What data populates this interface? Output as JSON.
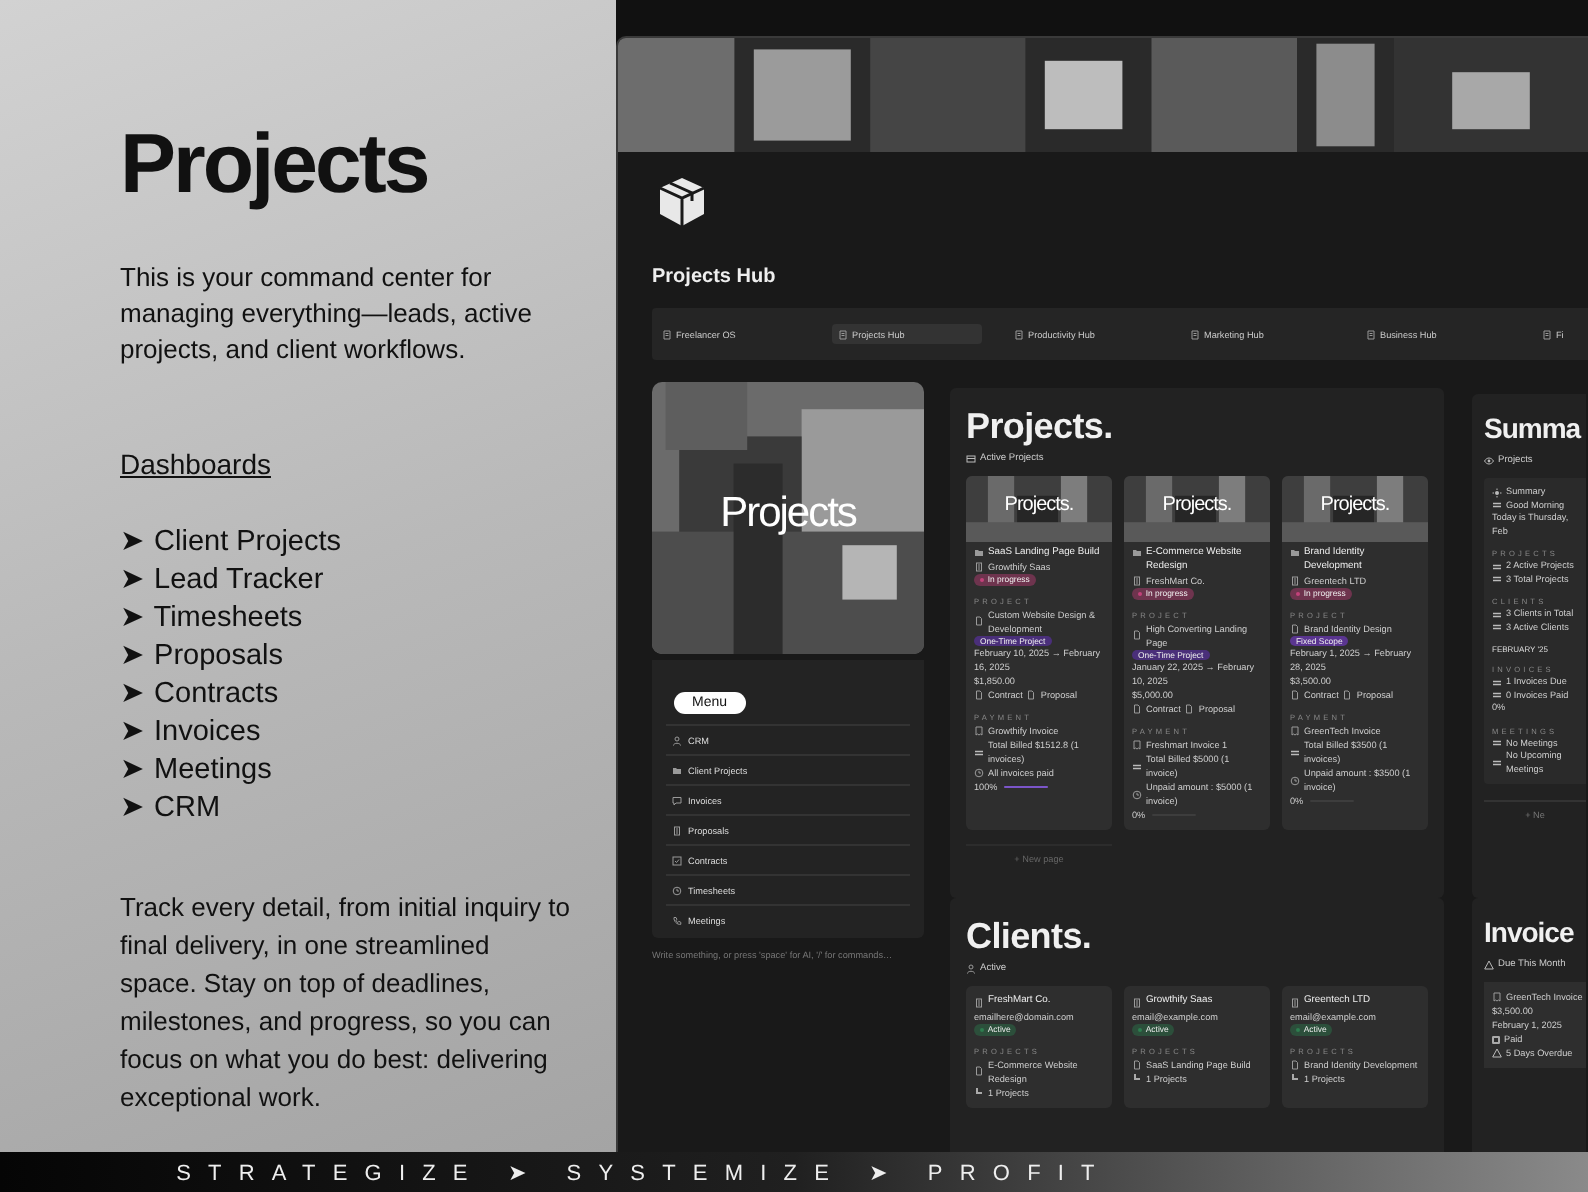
{
  "promo": {
    "title": "Projects",
    "intro": "This is your command center for managing everything—leads, active projects, and client workflows.",
    "dashboards_heading": "Dashboards",
    "dashboards": [
      "➤ Client Projects",
      "➤ Lead Tracker",
      "➤ Timesheets",
      "➤ Proposals",
      "➤ Contracts",
      "➤ Invoices",
      "➤ Meetings",
      "➤ CRM"
    ],
    "outro": "Track every detail, from initial inquiry to final delivery, in one streamlined space. Stay on top of deadlines, milestones, and progress, so you can focus on what you do best: delivering exceptional work."
  },
  "hub": {
    "title": "Projects Hub",
    "nav": [
      {
        "label": "Freelancer OS",
        "selected": false
      },
      {
        "label": "Projects Hub",
        "selected": true
      },
      {
        "label": "Productivity Hub",
        "selected": false
      },
      {
        "label": "Marketing Hub",
        "selected": false
      },
      {
        "label": "Business Hub",
        "selected": false
      },
      {
        "label": "Fi",
        "selected": false
      }
    ],
    "cover": {
      "title": "Projects"
    },
    "menu": {
      "title": "Menu",
      "items": [
        "CRM",
        "Client Projects",
        "Invoices",
        "Proposals",
        "Contracts",
        "Timesheets",
        "Meetings"
      ]
    },
    "placeholder": "Write something, or press 'space' for AI, '/' for commands…",
    "projects": {
      "title": "Projects.",
      "view": "Active Projects",
      "new_button": "+ New page",
      "cards": [
        {
          "image_label": "Projects.",
          "title": "SaaS Landing Page Build",
          "client": "Growthify Saas",
          "status": {
            "label": "In progress",
            "color": "#c2417a"
          },
          "project_heading": "PROJECT",
          "project": "Custom Website Design & Development",
          "type": {
            "label": "One-Time Project",
            "color": "#4a2f7a"
          },
          "dates": "February 10, 2025 → February 16, 2025",
          "amount": "$1,850.00",
          "docs": [
            "Contract",
            "Proposal"
          ],
          "payment_heading": "PAYMENT",
          "invoice": "Growthify Invoice",
          "billed": "Total Billed $1512.8 (1 invoices)",
          "balance": "All invoices paid",
          "percent": "100%",
          "level": 1
        },
        {
          "image_label": "Projects.",
          "title": "E-Commerce Website Redesign",
          "client": "FreshMart Co.",
          "status": {
            "label": "In progress",
            "color": "#c2417a"
          },
          "project_heading": "PROJECT",
          "project": "High Converting Landing Page",
          "type": {
            "label": "One-Time Project",
            "color": "#4a2f7a"
          },
          "dates": "January 22, 2025 → February 10, 2025",
          "amount": "$5,000.00",
          "docs": [
            "Contract",
            "Proposal"
          ],
          "payment_heading": "PAYMENT",
          "invoice": "Freshmart Invoice 1",
          "billed": "Total Billed $5000 (1 invoice)",
          "balance": "Unpaid amount : $5000 (1 invoice)",
          "percent": "0%",
          "level": 0
        },
        {
          "image_label": "Projects.",
          "title": "Brand Identity Development",
          "client": "Greentech LTD",
          "status": {
            "label": "In progress",
            "color": "#c2417a"
          },
          "project_heading": "PROJECT",
          "project": "Brand Identity Design",
          "type": {
            "label": "Fixed Scope",
            "color": "#5a3590"
          },
          "dates": "February 1, 2025 → February 28, 2025",
          "amount": "$3,500.00",
          "docs": [
            "Contract",
            "Proposal"
          ],
          "payment_heading": "PAYMENT",
          "invoice": "GreenTech Invoice",
          "billed": "Total Billed $3500 (1 invoices)",
          "balance": "Unpaid amount : $3500 (1 invoice)",
          "percent": "0%",
          "level": 0
        }
      ]
    },
    "summary": {
      "title": "Summa",
      "view": "Projects",
      "heading": "Summary",
      "greeting": "Good Morning",
      "date": "Today is Thursday, Feb",
      "sections": [
        {
          "label": "PROJECTS",
          "items": [
            "2 Active Projects",
            "3 Total Projects"
          ]
        },
        {
          "label": "CLIENTS",
          "items": [
            "3 Clients in Total",
            "3 Active Clients"
          ]
        },
        {
          "month": "FEBRUARY '25",
          "label": "INVOICES",
          "items": [
            "1 Invoices Due",
            "0 Invoices Paid"
          ],
          "percent": "0%"
        },
        {
          "label": "MEETINGS",
          "items": [
            "No Meetings",
            "No Upcoming Meetings"
          ]
        }
      ],
      "new_button": "+ Ne"
    },
    "clients": {
      "title": "Clients.",
      "view": "Active",
      "cards": [
        {
          "name": "FreshMart Co.",
          "email": "emailhere@domain.com",
          "status": {
            "label": "Active",
            "color": "#2e7d4f"
          },
          "projects_heading": "PROJECTS",
          "project": "E-Commerce Website Redesign",
          "count": "1 Projects"
        },
        {
          "name": "Growthify Saas",
          "email": "email@example.com",
          "status": {
            "label": "Active",
            "color": "#2e7d4f"
          },
          "projects_heading": "PROJECTS",
          "project": "SaaS Landing Page Build",
          "count": "1 Projects"
        },
        {
          "name": "Greentech LTD",
          "email": "email@example.com",
          "status": {
            "label": "Active",
            "color": "#2e7d4f"
          },
          "projects_heading": "PROJECTS",
          "project": "Brand Identity Development",
          "count": "1 Projects"
        }
      ]
    },
    "invoices": {
      "title": "Invoice",
      "view": "Due This Month",
      "cards": [
        {
          "name": "GreenTech Invoice",
          "amount": "$3,500.00",
          "date": "February 1, 2025",
          "paid_label": "Paid",
          "paid": false,
          "overdue": "5 Days Overdue"
        }
      ]
    }
  },
  "tagline": "STRATEGIZE ➤ SYSTEMIZE ➤ PROFIT"
}
